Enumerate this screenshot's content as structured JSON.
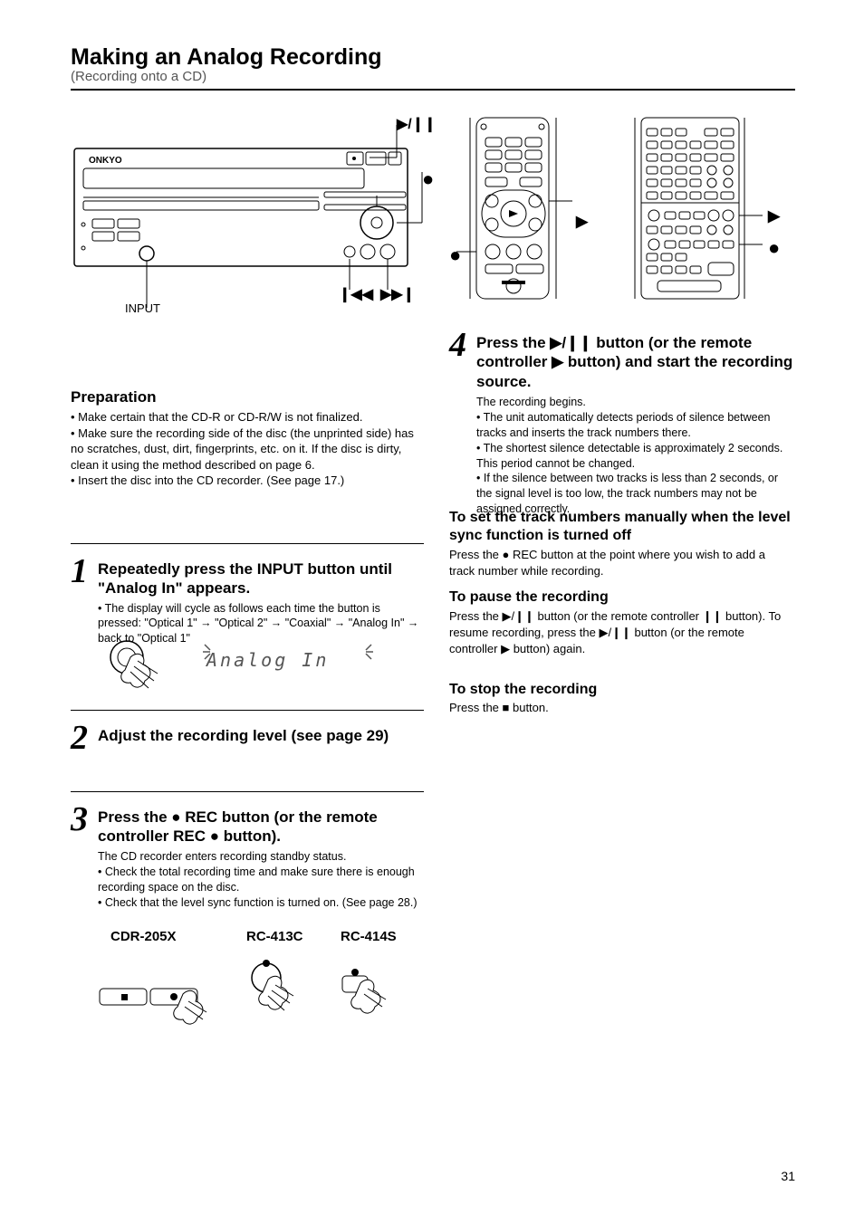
{
  "header": {
    "title_line": "Making an Analog Recording",
    "subtitle_line": "(Recording onto a CD)"
  },
  "page_number": "31",
  "top_rule": true,
  "top_diagram": {
    "left_device_brand": "ONKYO",
    "play_pause_glyph": "▶/❙❙",
    "rec_glyph": "●",
    "input_label": "INPUT",
    "prev_glyph": "❙◀◀",
    "next_glyph": "▶▶❙",
    "remote1_play": "▶",
    "remote1_rec": "●",
    "remote2_play": "▶",
    "remote2_rec": "●"
  },
  "left_col": {
    "preparation_hdr": "Preparation",
    "preparation_body": [
      "• Make certain that the CD-R or CD-R/W is not finalized.",
      "• Make sure the recording side of the disc (the unprinted side) has no scratches, dust, dirt, fingerprints, etc. on it. If the disc is dirty, clean it using the method described on page 6.",
      "• Insert the disc into the CD recorder. (See page 17.)"
    ],
    "step1_num": "1",
    "step1_text": "Repeatedly press the INPUT button until \"Analog In\" appears.",
    "step1_note": "• The display will cycle as follows each time the button is pressed: \"Optical 1\" → \"Optical 2\" → \"Coaxial\" → \"Analog In\" → back to \"Optical 1\"",
    "step1_display": "Analog In",
    "step2_num": "2",
    "step2_text": "Adjust the recording level (see page 29)",
    "step3_num": "3",
    "step3_text_a": "Press the ",
    "step3_bold_a": "● REC button (or the remote controller REC ● button).",
    "step3_notes": [
      "The CD recorder enters recording standby status.",
      "• Check the total recording time and make sure there is enough recording space on the disc.",
      "• Check that the level sync function is turned on. (See page 28.)"
    ],
    "models": {
      "a": "CDR-205X",
      "b": "RC-413C",
      "c": "RC-414S"
    }
  },
  "right_col": {
    "step4_num": "4",
    "step4_text": "Press the ▶/❙❙ button (or the remote controller ▶ button) and start the recording source.",
    "step4_notes": [
      "The recording begins.",
      "• The unit automatically detects periods of silence between tracks and inserts the track numbers there.",
      "• The shortest silence detectable is approximately 2 seconds. This period cannot be changed.",
      "• If the silence between two tracks is less than 2 seconds, or the signal level is too low, the track numbers may not be assigned correctly."
    ],
    "manual_hdr": "To set the track numbers manually when the level sync function is turned off",
    "manual_body": "Press the ● REC button at the point where you wish to add a track number while recording.",
    "pause_hdr": "To pause the recording",
    "pause_body": "Press the ▶/❙❙ button (or the remote controller ❙❙ button). To resume recording, press the ▶/❙❙ button (or the remote controller ▶ button) again.",
    "stop_hdr": "To stop the recording",
    "stop_body": "Press the ■ button."
  }
}
